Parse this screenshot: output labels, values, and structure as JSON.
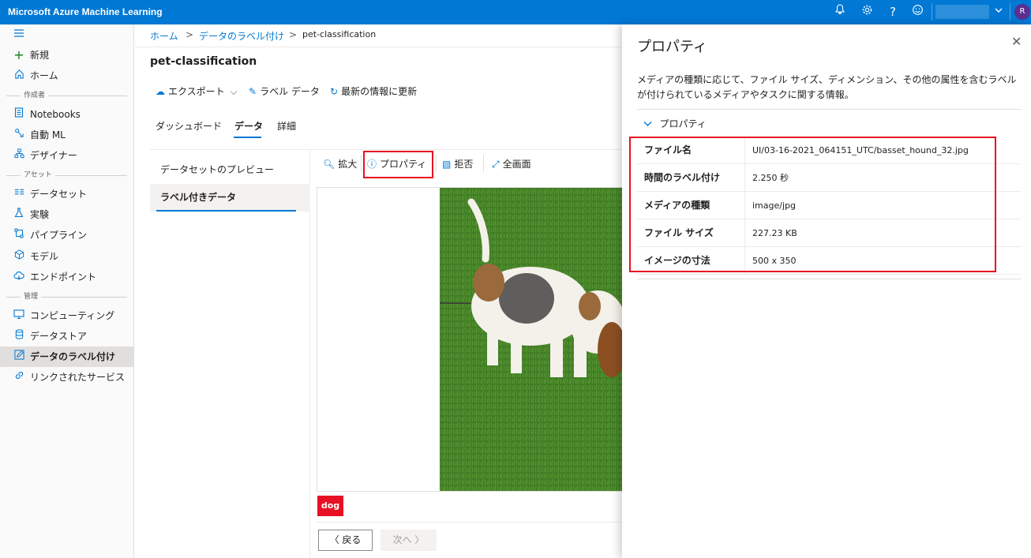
{
  "app": {
    "title": "Microsoft Azure Machine Learning",
    "avatar_letter": "R"
  },
  "sidebar": {
    "new": "新規",
    "home": "ホーム",
    "section_author": "作成者",
    "notebooks": "Notebooks",
    "automl": "自動 ML",
    "designer": "デザイナー",
    "section_assets": "アセット",
    "datasets": "データセット",
    "experiments": "実験",
    "pipelines": "パイプライン",
    "models": "モデル",
    "endpoints": "エンドポイント",
    "section_manage": "管理",
    "compute": "コンピューティング",
    "datastores": "データストア",
    "data_labeling": "データのラベル付け",
    "linked_services": "リンクされたサービス"
  },
  "breadcrumb": {
    "home": "ホーム",
    "labeling": "データのラベル付け",
    "project": "pet-classification"
  },
  "page": {
    "title": "pet-classification"
  },
  "toolbar": {
    "export": "エクスポート",
    "label_data": "ラベル データ",
    "refresh": "最新の情報に更新"
  },
  "tabs": {
    "dashboard": "ダッシュボード",
    "data": "データ",
    "details": "詳細"
  },
  "left_panel": {
    "preview": "データセットのプレビュー",
    "labeled": "ラベル付きデータ"
  },
  "image_toolbar": {
    "zoom": "拡大",
    "properties": "プロパティ",
    "reject": "拒否",
    "fullscreen": "全画面"
  },
  "image": {
    "tag": "dog"
  },
  "nav": {
    "back": "戻る",
    "next": "次へ"
  },
  "properties_panel": {
    "title": "プロパティ",
    "description": "メディアの種類に応じて、ファイル サイズ、ディメンション、その他の属性を含むラベルが付けられているメディアやタスクに関する情報。",
    "section": "プロパティ",
    "rows": [
      {
        "key": "ファイル名",
        "value": "UI/03-16-2021_064151_UTC/basset_hound_32.jpg"
      },
      {
        "key": "時間のラベル付け",
        "value": "2.250 秒"
      },
      {
        "key": "メディアの種類",
        "value": "image/jpg"
      },
      {
        "key": "ファイル サイズ",
        "value": "227.23 KB"
      },
      {
        "key": "イメージの寸法",
        "value": "500 x 350"
      }
    ]
  }
}
